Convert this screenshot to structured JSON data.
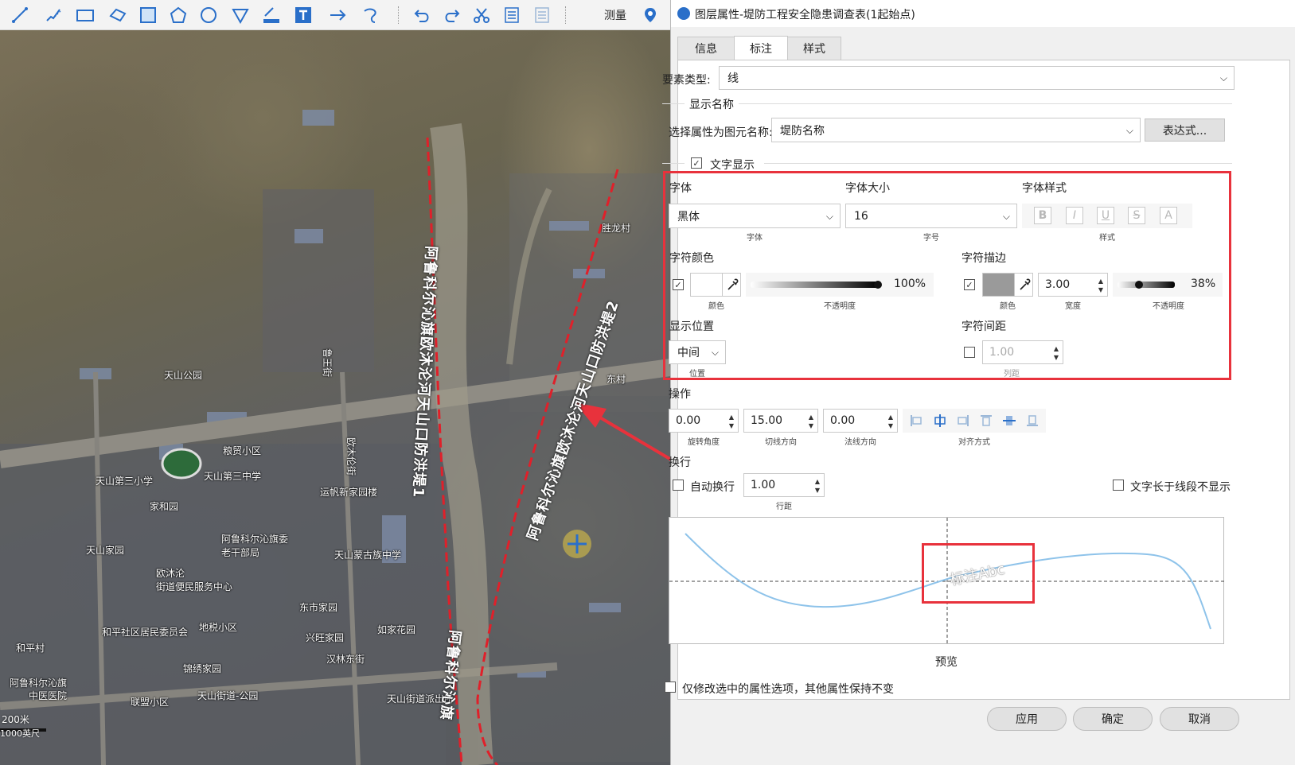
{
  "toolbar": {
    "tools": [
      "polyline-icon",
      "freehand-icon",
      "rectangle-icon",
      "polygon-icon",
      "square-icon",
      "pentagon-icon",
      "circle-icon",
      "triangle-icon",
      "ruler-icon",
      "text-icon",
      "arrow-icon",
      "curve-icon",
      "undo-icon",
      "redo-icon",
      "cut-icon",
      "document-icon",
      "list-icon"
    ],
    "measure_label": "测量",
    "measure_icon": "location-pin-icon"
  },
  "map": {
    "labels": {
      "shenglong": "胜龙村",
      "dongcun": "东村",
      "tianshan_park": "天山公园",
      "luhe_road": "鲁王街",
      "ou_road": "欧木伦街",
      "gengfu": "粮贸小区",
      "school3": "天山第三小学",
      "middle3": "天山第三中学",
      "jiahe": "家和园",
      "yunfan": "运帆新家园楼",
      "tianshan_home": "天山家园",
      "aruke_gov": "阿鲁科尔沁旗委",
      "old_cadre": "老干部局",
      "mongol_school": "天山蒙古族中学",
      "oumulun": "欧沐沦",
      "street_center": "街道便民服务中心",
      "donshi": "东市家园",
      "heping": "和平社区居民委员会",
      "diyou": "地税小区",
      "xingwang": "兴旺家园",
      "rujia": "如家花园",
      "heping_village": "和平村",
      "hanlin": "汉林东街",
      "jinsheng": "锦绣家园",
      "aruke_flag": "阿鲁科尔沁旗",
      "hospital": "中医医院",
      "tianshan_police": "天山街道派出所",
      "tianshan_street": "天山街道-公园",
      "yuan": "联盟小区"
    },
    "line_label_1": "阿鲁科尔沁旗欧沐沦河天山口防洪堤1",
    "line_label_2": "阿鲁科尔沁旗欧沐沦河天山口防洪堤2",
    "line_label_3": "阿鲁科尔沁旗",
    "scale_text": "200米",
    "scale_text_2": "1000英尺"
  },
  "dialog": {
    "title": "图层属性-堤防工程安全隐患调查表(1起始点)",
    "tabs": [
      "信息",
      "标注",
      "样式"
    ],
    "active_tab": "标注",
    "feature_type_label": "要素类型:",
    "feature_type_value": "线",
    "display_name_group": "显示名称",
    "select_attr_label": "选择属性为图元名称:",
    "select_attr_value": "堤防名称",
    "expression_button": "表达式...",
    "text_display_label": "文字显示",
    "text_display_checked": true,
    "font_label": "字体",
    "font_value": "黑体",
    "font_sub": "字体",
    "font_size_label": "字体大小",
    "font_size_value": "16",
    "font_size_sub": "字号",
    "font_style_label": "字体样式",
    "font_style_sub": "样式",
    "font_style_buttons": [
      "B",
      "I",
      "U",
      "S",
      "A"
    ],
    "char_color_label": "字符颜色",
    "char_color_checked": true,
    "char_color_sub": "颜色",
    "char_color_swatch": "#ffffff",
    "char_color_opacity": "100%",
    "char_color_opacity_value": 1.0,
    "opacity_sub": "不透明度",
    "outline_label": "字符描边",
    "outline_checked": true,
    "outline_swatch": "#9a9a9a",
    "outline_color_sub": "颜色",
    "outline_width": "3.00",
    "outline_width_sub": "宽度",
    "outline_opacity": "38%",
    "outline_opacity_value": 0.38,
    "outline_opacity_sub": "不透明度",
    "position_label": "显示位置",
    "position_value": "中间",
    "position_sub": "位置",
    "spacing_label": "字符间距",
    "spacing_checked": false,
    "spacing_value": "1.00",
    "spacing_sub": "列距",
    "operation_label": "操作",
    "rotate_value": "0.00",
    "rotate_sub": "旋转角度",
    "tangent_value": "15.00",
    "tangent_sub": "切线方向",
    "normal_value": "0.00",
    "normal_sub": "法线方向",
    "align_sub": "对齐方式",
    "align_icons": [
      "align-left-icon",
      "align-center-icon",
      "align-right-icon",
      "align-top-icon",
      "align-middle-icon",
      "align-bottom-icon"
    ],
    "wrap_label": "换行",
    "auto_wrap_label": "自动换行",
    "auto_wrap_checked": false,
    "line_spacing_value": "1.00",
    "line_spacing_sub": "行距",
    "hide_long_label": "文字长于线段不显示",
    "hide_long_checked": false,
    "preview_text": "标注Abc",
    "preview_label": "预览",
    "only_modify_label": "仅修改选中的属性选项，其他属性保持不变",
    "only_modify_checked": false,
    "apply_button": "应用",
    "ok_button": "确定",
    "cancel_button": "取消"
  },
  "colors": {
    "highlight_red": "#e8323c",
    "accent_blue": "#2a6fc9",
    "dashed_line_red": "#e0202a",
    "preview_curve": "#8ec3ea"
  }
}
